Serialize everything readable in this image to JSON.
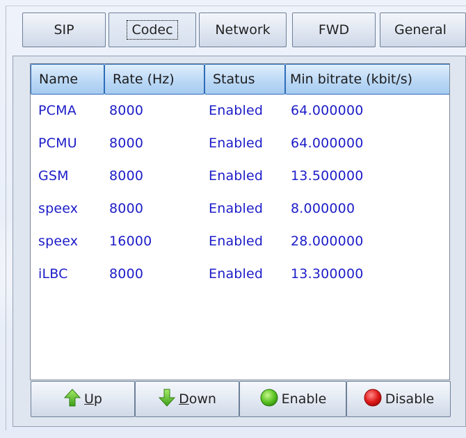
{
  "tabs": [
    {
      "label": "SIP"
    },
    {
      "label": "Codec"
    },
    {
      "label": "Network"
    },
    {
      "label": "FWD"
    },
    {
      "label": "General"
    }
  ],
  "active_tab": "Codec",
  "codec_table": {
    "columns": [
      "Name",
      "Rate (Hz)",
      "Status",
      "Min bitrate (kbit/s)"
    ],
    "rows": [
      {
        "name": "PCMA",
        "rate": "8000",
        "status": "Enabled",
        "min_bitrate": "64.000000"
      },
      {
        "name": "PCMU",
        "rate": "8000",
        "status": "Enabled",
        "min_bitrate": "64.000000"
      },
      {
        "name": "GSM",
        "rate": "8000",
        "status": "Enabled",
        "min_bitrate": "13.500000"
      },
      {
        "name": "speex",
        "rate": "8000",
        "status": "Enabled",
        "min_bitrate": "8.000000"
      },
      {
        "name": "speex",
        "rate": "16000",
        "status": "Enabled",
        "min_bitrate": "28.000000"
      },
      {
        "name": "iLBC",
        "rate": "8000",
        "status": "Enabled",
        "min_bitrate": "13.300000"
      }
    ],
    "text_color": "#1c1cc8",
    "header_color": "#b9d7f5"
  },
  "buttons": {
    "up": {
      "mnemonic": "U",
      "rest": "p",
      "icon": "green-up-arrow-icon"
    },
    "down": {
      "mnemonic": "D",
      "rest": "own",
      "icon": "green-down-arrow-icon"
    },
    "enable": {
      "label": "Enable",
      "icon": "green-circle-icon"
    },
    "disable": {
      "label": "Disable",
      "icon": "red-circle-icon"
    }
  }
}
